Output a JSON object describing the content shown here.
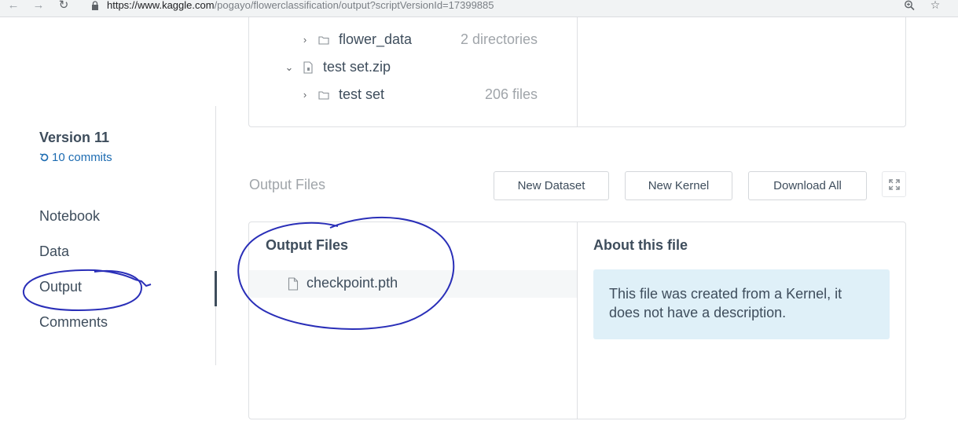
{
  "browser": {
    "url_host": "https://www.kaggle.com",
    "url_path": "/pogayo/flowerclassification/output?scriptVersionId=17399885"
  },
  "sidebar": {
    "version_title": "Version 11",
    "commits_label": "10 commits",
    "items": [
      {
        "label": "Notebook"
      },
      {
        "label": "Data"
      },
      {
        "label": "Output",
        "active": true
      },
      {
        "label": "Comments"
      }
    ]
  },
  "tree": {
    "rows": [
      {
        "name": "flower_data",
        "meta": "2 directories",
        "icon": "folder-icon",
        "expander": "chevron-right-icon"
      },
      {
        "name": "test set.zip",
        "meta": "",
        "icon": "zip-file-icon",
        "expander": "chevron-down-icon"
      },
      {
        "name": "test set",
        "meta": "206 files",
        "icon": "folder-icon",
        "expander": "chevron-right-icon"
      }
    ]
  },
  "output": {
    "heading": "Output Files",
    "buttons": {
      "new_dataset": "New Dataset",
      "new_kernel": "New Kernel",
      "download_all": "Download All"
    },
    "files_title": "Output Files",
    "files": [
      {
        "name": "checkpoint.pth"
      }
    ],
    "about_title": "About this file",
    "about_text": "This file was created from a Kernel, it does not have a description."
  },
  "colors": {
    "accent_link": "#1c6bb1",
    "text_dark": "#3e4d5c",
    "info_box": "#dff0f8",
    "annotation_ink": "#2a2fb8"
  }
}
